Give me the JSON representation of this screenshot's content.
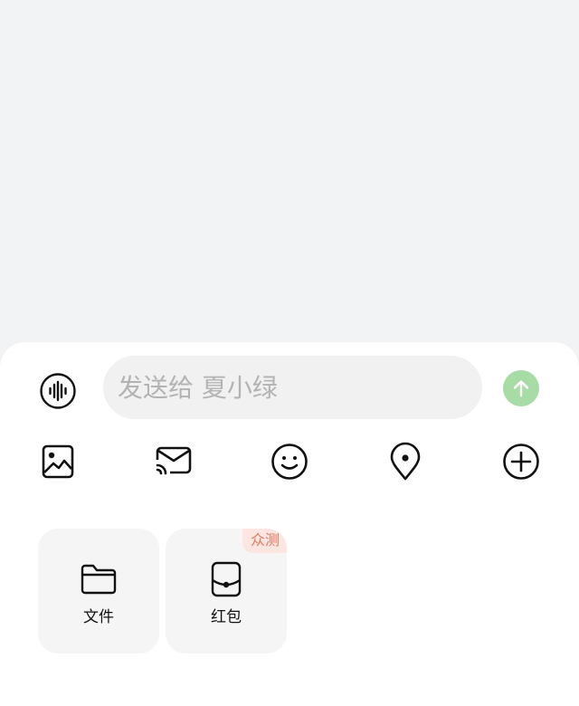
{
  "input": {
    "placeholder": "发送给 夏小绿",
    "value": ""
  },
  "icons": {
    "voice": "voice-wave-icon",
    "send": "arrow-up-icon",
    "image": "image-icon",
    "mail": "mail-icon",
    "emoji": "smile-icon",
    "location": "location-pin-icon",
    "more": "plus-circle-icon",
    "file": "folder-icon",
    "redpacket": "red-packet-icon"
  },
  "cards": [
    {
      "label": "文件"
    },
    {
      "label": "红包",
      "badge": "众测"
    }
  ],
  "colors": {
    "send_button": "#a8dca6",
    "badge_bg": "#fde6e1",
    "badge_text": "#e07a5f"
  }
}
